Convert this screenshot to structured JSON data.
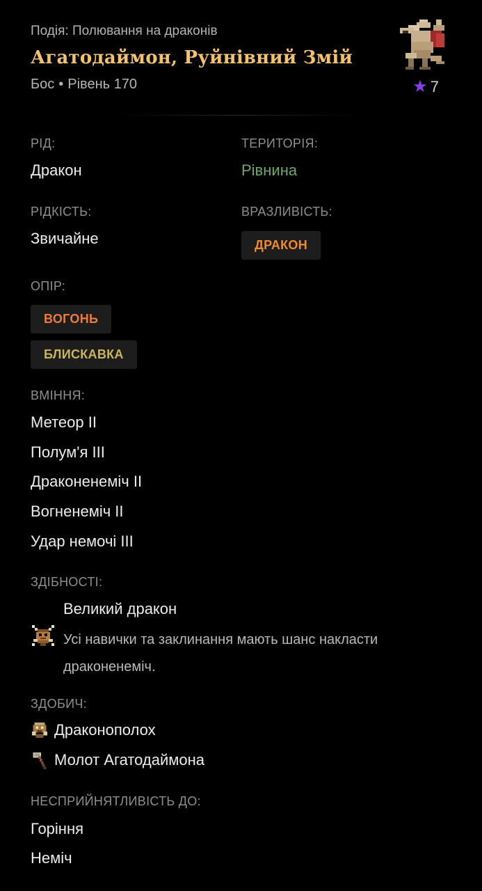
{
  "header": {
    "event": "Подія: Полювання на драконів",
    "name": "Агатодаймон, Руйнівний Змій",
    "type": "Бос",
    "separator": "•",
    "level": "Рівень 170",
    "stars_icon": "star-icon",
    "stars": "7"
  },
  "fields": {
    "race_label": "РІД:",
    "race_value": "Дракон",
    "territory_label": "ТЕРИТОРІЯ:",
    "territory_value": "Рівнина",
    "rarity_label": "РІДКІСТЬ:",
    "rarity_value": "Звичайне",
    "weakness_label": "ВРАЗЛИВІСТЬ:",
    "weakness_chips": [
      "ДРАКОН"
    ],
    "resistance_label": "ОПІР:",
    "resistance_chips": [
      "ВОГОНЬ",
      "БЛИСКАВКА"
    ]
  },
  "skills": {
    "label": "ВМІННЯ:",
    "items": [
      "Метеор II",
      "Полум'я III",
      "Драконенеміч II",
      "Вогненеміч II",
      "Удар немочі III"
    ]
  },
  "abilities": {
    "label": "ЗДІБНОСТІ:",
    "items": [
      {
        "title": "Великий дракон",
        "description": "Усі навички та заклинання мають шанс накласти драконенеміч.",
        "icon": "bug-badge-icon"
      }
    ]
  },
  "loot": {
    "label": "ЗДОБИЧ:",
    "items": [
      {
        "name": "Драконополох",
        "icon": "dragon-scare-icon"
      },
      {
        "name": "Молот Агатодаймона",
        "icon": "hammer-icon"
      }
    ]
  },
  "immunities": {
    "label": "НЕСПРИЙНЯТЛИВІСТЬ ДО:",
    "items": [
      "Горіння",
      "Неміч"
    ]
  },
  "colors": {
    "background": "#000000",
    "name_gold": "#f4c26a",
    "territory_green": "#6fa86a",
    "weakness_orange": "#f08a2d",
    "fire_orange": "#f07a3a",
    "lightning_yellow": "#c9b65a",
    "star_purple": "#8a3cf0"
  }
}
